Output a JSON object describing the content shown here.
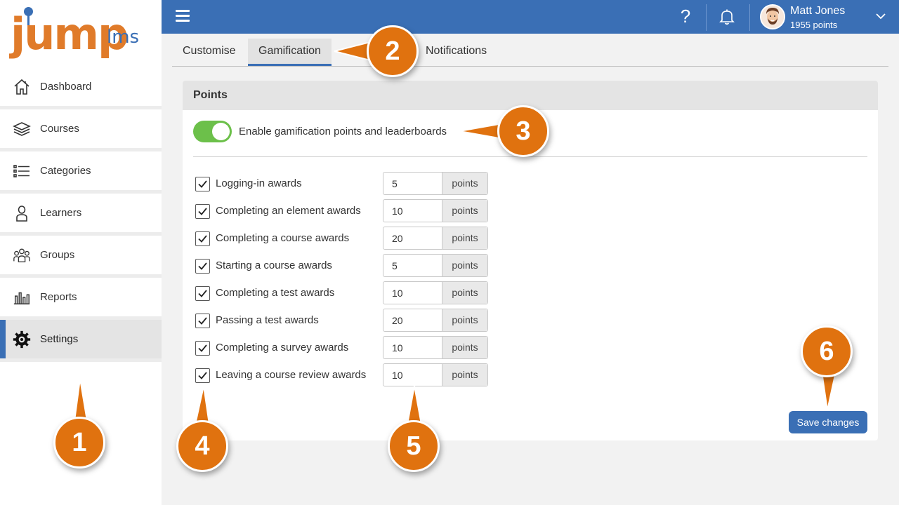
{
  "logo": {
    "jump": "jump",
    "lms": "lms"
  },
  "sidebar": {
    "items": [
      {
        "label": "Dashboard",
        "icon": "home-icon"
      },
      {
        "label": "Courses",
        "icon": "layers-icon"
      },
      {
        "label": "Categories",
        "icon": "list-icon"
      },
      {
        "label": "Learners",
        "icon": "person-icon"
      },
      {
        "label": "Groups",
        "icon": "group-icon"
      },
      {
        "label": "Reports",
        "icon": "bar-chart-icon"
      },
      {
        "label": "Settings",
        "icon": "gear-icon",
        "active": true
      }
    ]
  },
  "topbar": {
    "help": "?",
    "user_name": "Matt Jones",
    "user_points": "1955 points"
  },
  "tabs": [
    {
      "label": "Customise"
    },
    {
      "label": "Gamification",
      "active": true
    },
    {
      "label": "Notifications"
    }
  ],
  "panel": {
    "title": "Points",
    "toggle_label": "Enable gamification points and leaderboards",
    "toggle_on": true,
    "points_unit": "points",
    "awards": [
      {
        "label": "Logging-in awards",
        "value": "5",
        "checked": true
      },
      {
        "label": "Completing an element awards",
        "value": "10",
        "checked": true
      },
      {
        "label": "Completing a course awards",
        "value": "20",
        "checked": true
      },
      {
        "label": "Starting a course awards",
        "value": "5",
        "checked": true
      },
      {
        "label": "Completing a test awards",
        "value": "10",
        "checked": true
      },
      {
        "label": "Passing a test awards",
        "value": "20",
        "checked": true
      },
      {
        "label": "Completing a survey awards",
        "value": "10",
        "checked": true
      },
      {
        "label": "Leaving a course review awards",
        "value": "10",
        "checked": true
      }
    ],
    "save_label": "Save changes"
  },
  "callouts": [
    "1",
    "2",
    "3",
    "4",
    "5",
    "6"
  ],
  "colors": {
    "primary": "#3a6fb5",
    "accent": "#e0720f",
    "toggle_on": "#6cc04a"
  }
}
